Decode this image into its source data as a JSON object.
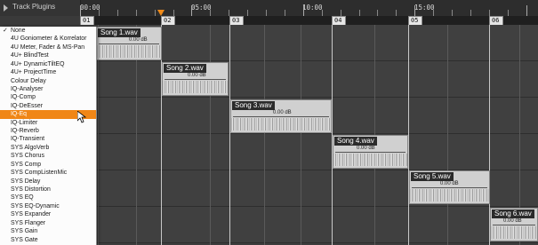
{
  "header": {
    "title": "Track Plugins"
  },
  "timeline": {
    "labels": [
      "00:00",
      "05:00",
      "10:00",
      "15:00"
    ],
    "markers": [
      "01",
      "02",
      "03",
      "04",
      "05",
      "06"
    ]
  },
  "clips": [
    {
      "name": "Song 1.wav",
      "gain": "0.00 dB"
    },
    {
      "name": "Song 2.wav",
      "gain": "0.00 dB"
    },
    {
      "name": "Song 3.wav",
      "gain": "0.00 dB"
    },
    {
      "name": "Song 4.wav",
      "gain": "0.00 dB"
    },
    {
      "name": "Song 5.wav",
      "gain": "0.00 dB"
    },
    {
      "name": "Song 6.wav",
      "gain": "0.00 dB"
    }
  ],
  "dropdown": {
    "checked_item": "None",
    "selected_item": "IQ-Eq",
    "items": [
      "None",
      "4U Goniometer & Korrelator",
      "4U Meter, Fader & MS-Pan",
      "4U+ BlindTest",
      "4U+ DynamicTiltEQ",
      "4U+ ProjectTime",
      "Colour Delay",
      "IQ-Analyser",
      "IQ-Comp",
      "IQ-DeEsser",
      "IQ-Eq",
      "IQ-Limiter",
      "IQ-Reverb",
      "IQ-Transient",
      "SYS AlgoVerb",
      "SYS Chorus",
      "SYS Comp",
      "SYS CompListenMic",
      "SYS Delay",
      "SYS Distortion",
      "SYS EQ",
      "SYS EQ-Dynamic",
      "SYS Expander",
      "SYS Flanger",
      "SYS Gain",
      "SYS Gate"
    ]
  },
  "colors": {
    "accent": "#f08616",
    "background": "#3a3a3a"
  }
}
